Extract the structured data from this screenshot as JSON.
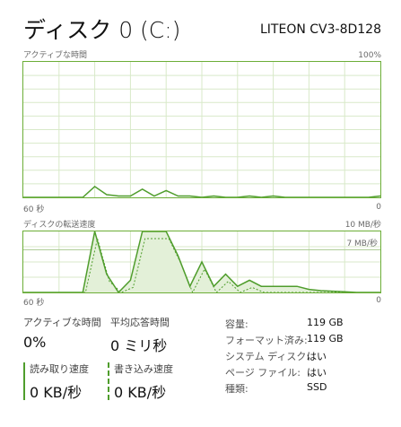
{
  "header": {
    "title": "ディスク 0 (C:)",
    "model": "LITEON CV3-8D128"
  },
  "active_time_chart": {
    "top_label": "アクティブな時間",
    "max_label": "100%",
    "time_label": "60 秒",
    "min_label": "0"
  },
  "transfer_chart": {
    "top_label": "ディスクの転送速度",
    "max_label": "10 MB/秒",
    "ref_label": "7 MB/秒",
    "time_label": "60 秒",
    "min_label": "0"
  },
  "stats": {
    "active_time_label": "アクティブな時間",
    "active_time_value": "0%",
    "response_label": "平均応答時間",
    "response_value": "0 ミリ秒",
    "read_label": "読み取り速度",
    "read_value": "0 KB/秒",
    "write_label": "書き込み速度",
    "write_value": "0 KB/秒"
  },
  "properties": {
    "capacity_key": "容量:",
    "capacity_value": "119 GB",
    "formatted_key": "フォーマット済み:",
    "formatted_value": "119 GB",
    "system_disk_key": "システム ディスク:",
    "system_disk_value": "はい",
    "pagefile_key": "ページ ファイル:",
    "pagefile_value": "はい",
    "type_key": "種類:",
    "type_value": "SSD"
  },
  "colors": {
    "accent": "#6cae37",
    "grid": "#d8e9c9",
    "line": "#4f9d2c"
  },
  "chart_data": [
    {
      "type": "line",
      "x": [
        60,
        58,
        56,
        54,
        52,
        50,
        48,
        46,
        44,
        42,
        40,
        38,
        36,
        34,
        32,
        30,
        28,
        26,
        24,
        22,
        20,
        18,
        16,
        14,
        12,
        10,
        8,
        6,
        4,
        2,
        0
      ],
      "series": [
        {
          "values": [
            0,
            0,
            0,
            0,
            0,
            0,
            8,
            2,
            1,
            1,
            6,
            1,
            5,
            1,
            1,
            0,
            1,
            0,
            0,
            1,
            0,
            1,
            0,
            0,
            0,
            0,
            0,
            0,
            0,
            0,
            1
          ]
        }
      ],
      "xlabel": "60 秒",
      "ylim": [
        0,
        100
      ],
      "grid": true
    },
    {
      "type": "area",
      "x": [
        60,
        58,
        56,
        54,
        52,
        50,
        48,
        46,
        44,
        42,
        40,
        38,
        36,
        34,
        32,
        30,
        28,
        26,
        24,
        22,
        20,
        18,
        16,
        14,
        12,
        10,
        8,
        6,
        4,
        2,
        0
      ],
      "series": [
        {
          "values": [
            0,
            0,
            0,
            0,
            0,
            0,
            10,
            3,
            0,
            2,
            10,
            10,
            10,
            6,
            1,
            5,
            1,
            3,
            1,
            2,
            1,
            1,
            1,
            1,
            0.5,
            0.3,
            0.2,
            0.1,
            0,
            0,
            0
          ]
        }
      ],
      "xlabel": "60 秒",
      "ylim": [
        0,
        10
      ],
      "grid": true
    }
  ]
}
